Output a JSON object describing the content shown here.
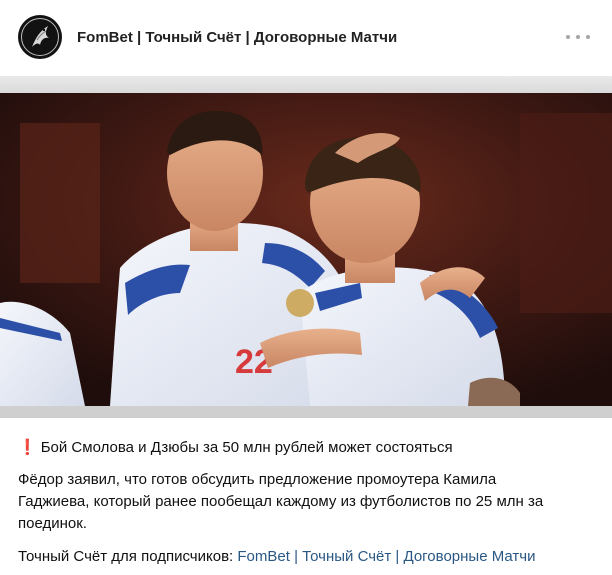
{
  "post": {
    "channel_name": "FomBet | Точный Счёт | Договорные Матчи",
    "more_icon": "more-horizontal-icon",
    "image_description": "",
    "headline_icon": "❗",
    "headline": "Бой Смолова и Дзюбы за 50 млн рублей может состояться",
    "paragraph_line1": "Фёдор заявил, что готов обсудить предложение промоутера Камила",
    "paragraph_line2": "Гаджиева, который ранее пообещал каждому из футболистов по 25 млн за",
    "paragraph_line3": "поединок.",
    "footer_prefix": "Точный Счёт для подписчиков:",
    "footer_link": "FomBet | Точный Счёт | Договорные Матчи"
  },
  "colors": {
    "link": "#2a5885",
    "accent_red": "#e2332e",
    "kit_blue": "#2c4fa8"
  }
}
